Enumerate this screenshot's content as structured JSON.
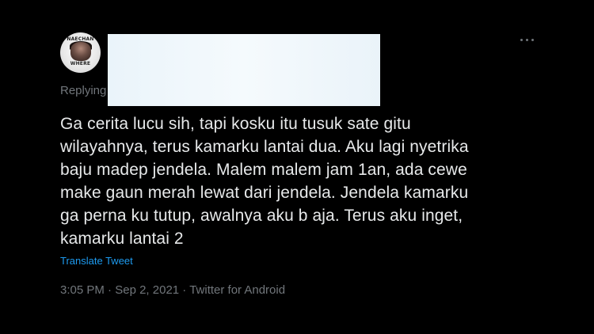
{
  "tweet": {
    "avatar": {
      "top_text": "NAECHAN",
      "bottom_text": "WHERE"
    },
    "replying_label": "Replying",
    "text_lines": [
      "Ga cerita lucu sih, tapi kosku itu tusuk sate gitu",
      "wilayahnya, terus kamarku lantai dua. Aku lagi nyetrika",
      "baju madep jendela. Malem malem jam 1an, ada cewe",
      "make gaun merah lewat dari jendela. Jendela kamarku",
      "ga perna ku tutup, awalnya aku b aja. Terus aku inget,",
      "kamarku lantai 2"
    ],
    "translate_label": "Translate Tweet",
    "time": "3:05 PM",
    "separator": " · ",
    "date": "Sep 2, 2021",
    "source": "Twitter for Android",
    "icons": {
      "more": "more-horizontal-icon"
    },
    "colors": {
      "background": "#000000",
      "text": "#e7e9ea",
      "muted": "#71767b",
      "link": "#1d9bf0"
    }
  }
}
